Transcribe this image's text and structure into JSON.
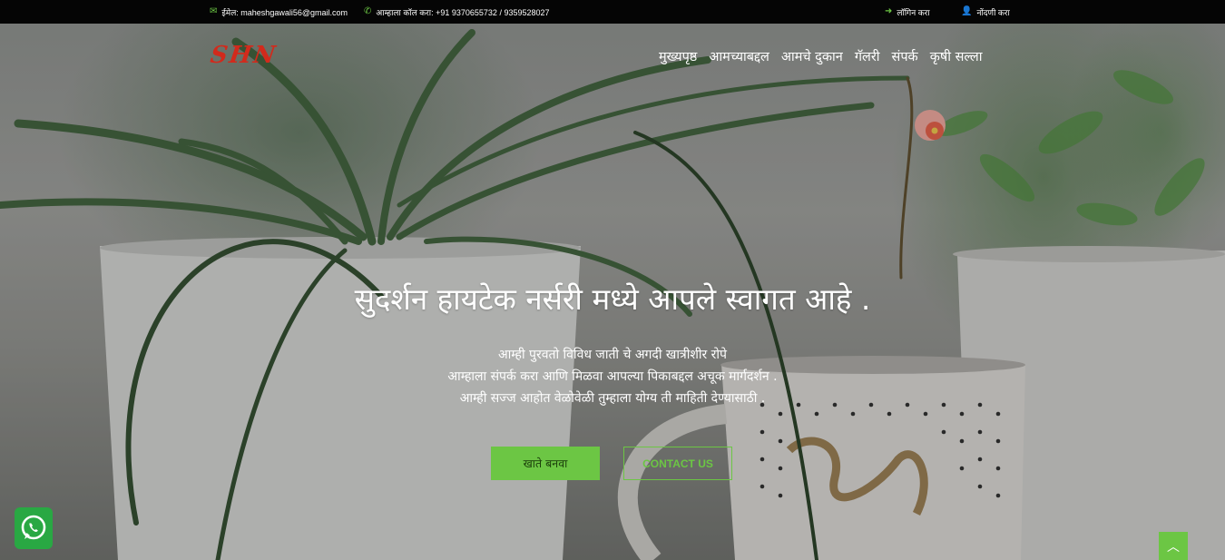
{
  "topbar": {
    "email_icon": "envelope-icon",
    "email": "ईमेल: maheshgawali56@gmail.com",
    "phone_icon": "phone-icon",
    "phone": "आम्हाला कॉल करा: +91 9370655732 / 9359528027",
    "login_icon": "sign-in-icon",
    "login": "लॉगिन करा",
    "register_icon": "user-plus-icon",
    "register": "नोंदणी करा"
  },
  "header": {
    "logo": "SHN",
    "nav": [
      "मुख्यपृष्ठ",
      "आमच्याबद्दल",
      "आमचे दुकान",
      "गॅलरी",
      "संपर्क",
      "कृषी सल्ला"
    ]
  },
  "hero": {
    "title": "सुदर्शन हायटेक नर्सरी मध्ये आपले स्वागत आहे .",
    "lines": [
      "आम्ही पुरवतो विविध जाती चे अगदी खात्रीशीर रोपे",
      "आम्हाला संपर्क करा आणि मिळवा आपल्या पिकाबद्दल अचूक मार्गदर्शन .",
      "आम्ही सज्ज आहोत वेळोवेळी तुम्हाला योग्य ती माहिती देण्यासाठी ."
    ],
    "primary_button": "खाते बनवा",
    "secondary_button": "CONTACT US"
  },
  "floating": {
    "whatsapp_icon": "whatsapp-icon",
    "scroll_top_icon": "chevron-up-icon"
  },
  "colors": {
    "accent": "#6cc644",
    "logo": "#d22a1c",
    "topbar": "#050505",
    "whatsapp": "#29a843"
  }
}
